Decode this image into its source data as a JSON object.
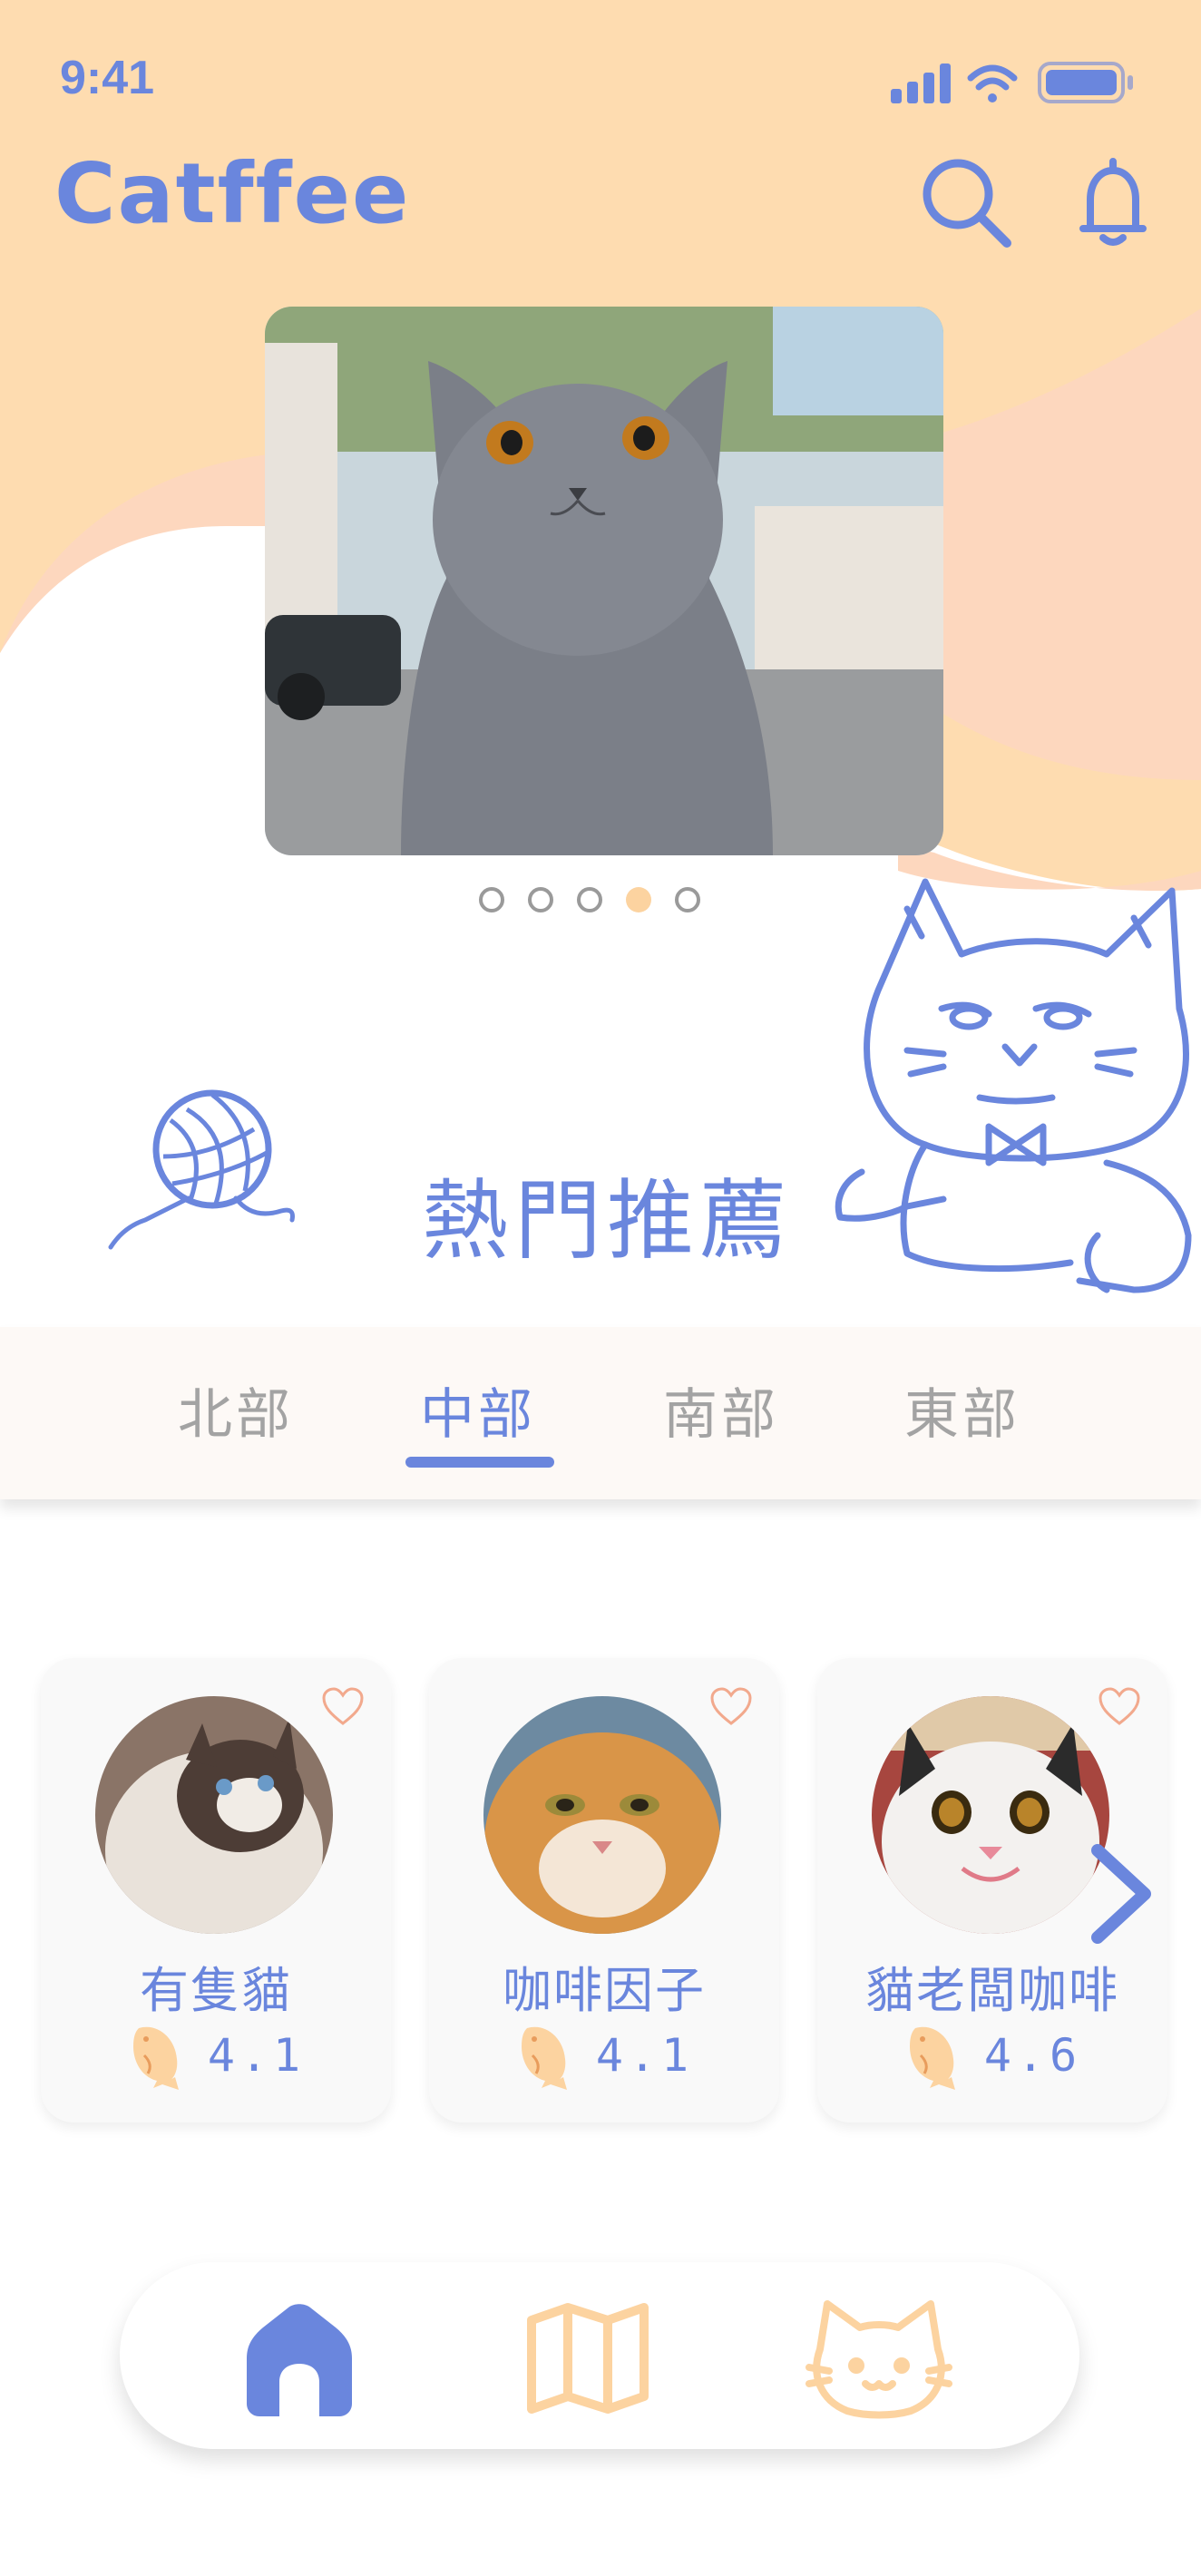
{
  "status_bar": {
    "time": "9:41"
  },
  "header": {
    "app_title": "Catffee"
  },
  "banner": {
    "slide_count": 5,
    "active_slide": 4
  },
  "section": {
    "title": "熱門推薦"
  },
  "region_tabs": [
    {
      "label": "北部",
      "active": false
    },
    {
      "label": "中部",
      "active": true
    },
    {
      "label": "南部",
      "active": false
    },
    {
      "label": "東部",
      "active": false
    }
  ],
  "cafes": [
    {
      "name": "有隻貓",
      "rating": "4.1"
    },
    {
      "name": "咖啡因子",
      "rating": "4.1"
    },
    {
      "name": "貓老闆咖啡",
      "rating": "4.6"
    }
  ],
  "bottom_nav": [
    {
      "icon": "home-icon",
      "active": true
    },
    {
      "icon": "map-icon",
      "active": false
    },
    {
      "icon": "cat-face-icon",
      "active": false
    }
  ],
  "colors": {
    "primary": "#6a86dd",
    "peach": "#fcd3a0",
    "header_bg": "#fedcb0",
    "inactive_text": "#a3a3a3"
  }
}
